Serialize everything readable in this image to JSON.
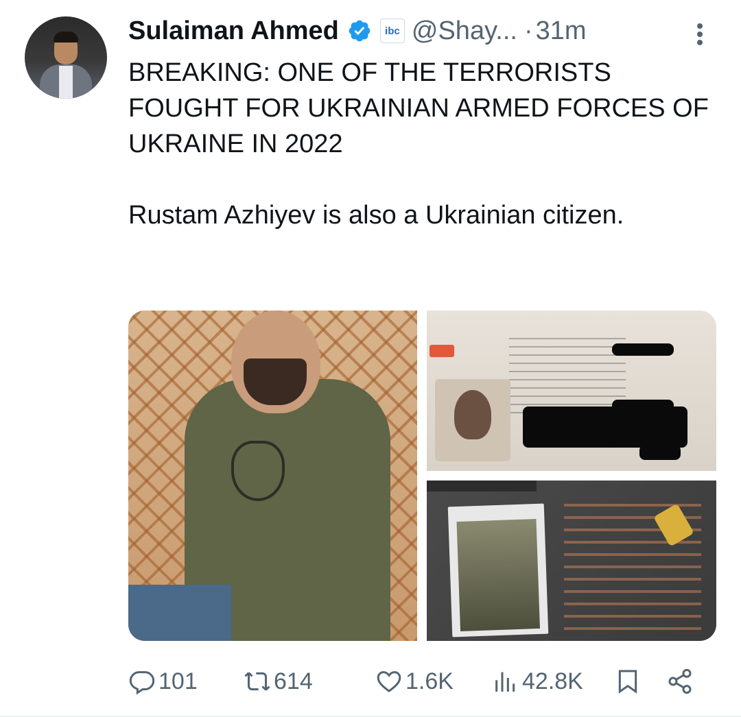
{
  "author": {
    "name": "Sulaiman Ahmed",
    "handle": "@Shay...",
    "affiliation_badge": "ibc",
    "time": "31m",
    "verified_color": "#1d9bf0"
  },
  "tweet": {
    "text": "BREAKING: ONE OF THE TERRORISTS FOUGHT FOR UKRAINIAN ARMED FORCES OF UKRAINE IN 2022\n\nRustam Azhiyev is also a Ukrainian citizen."
  },
  "actions": {
    "replies": "101",
    "reposts": "614",
    "likes": "1.6K",
    "views": "42.8K"
  },
  "icons": [
    "verified-icon",
    "more-icon",
    "reply-icon",
    "repost-icon",
    "like-icon",
    "views-icon",
    "bookmark-icon",
    "share-icon"
  ]
}
